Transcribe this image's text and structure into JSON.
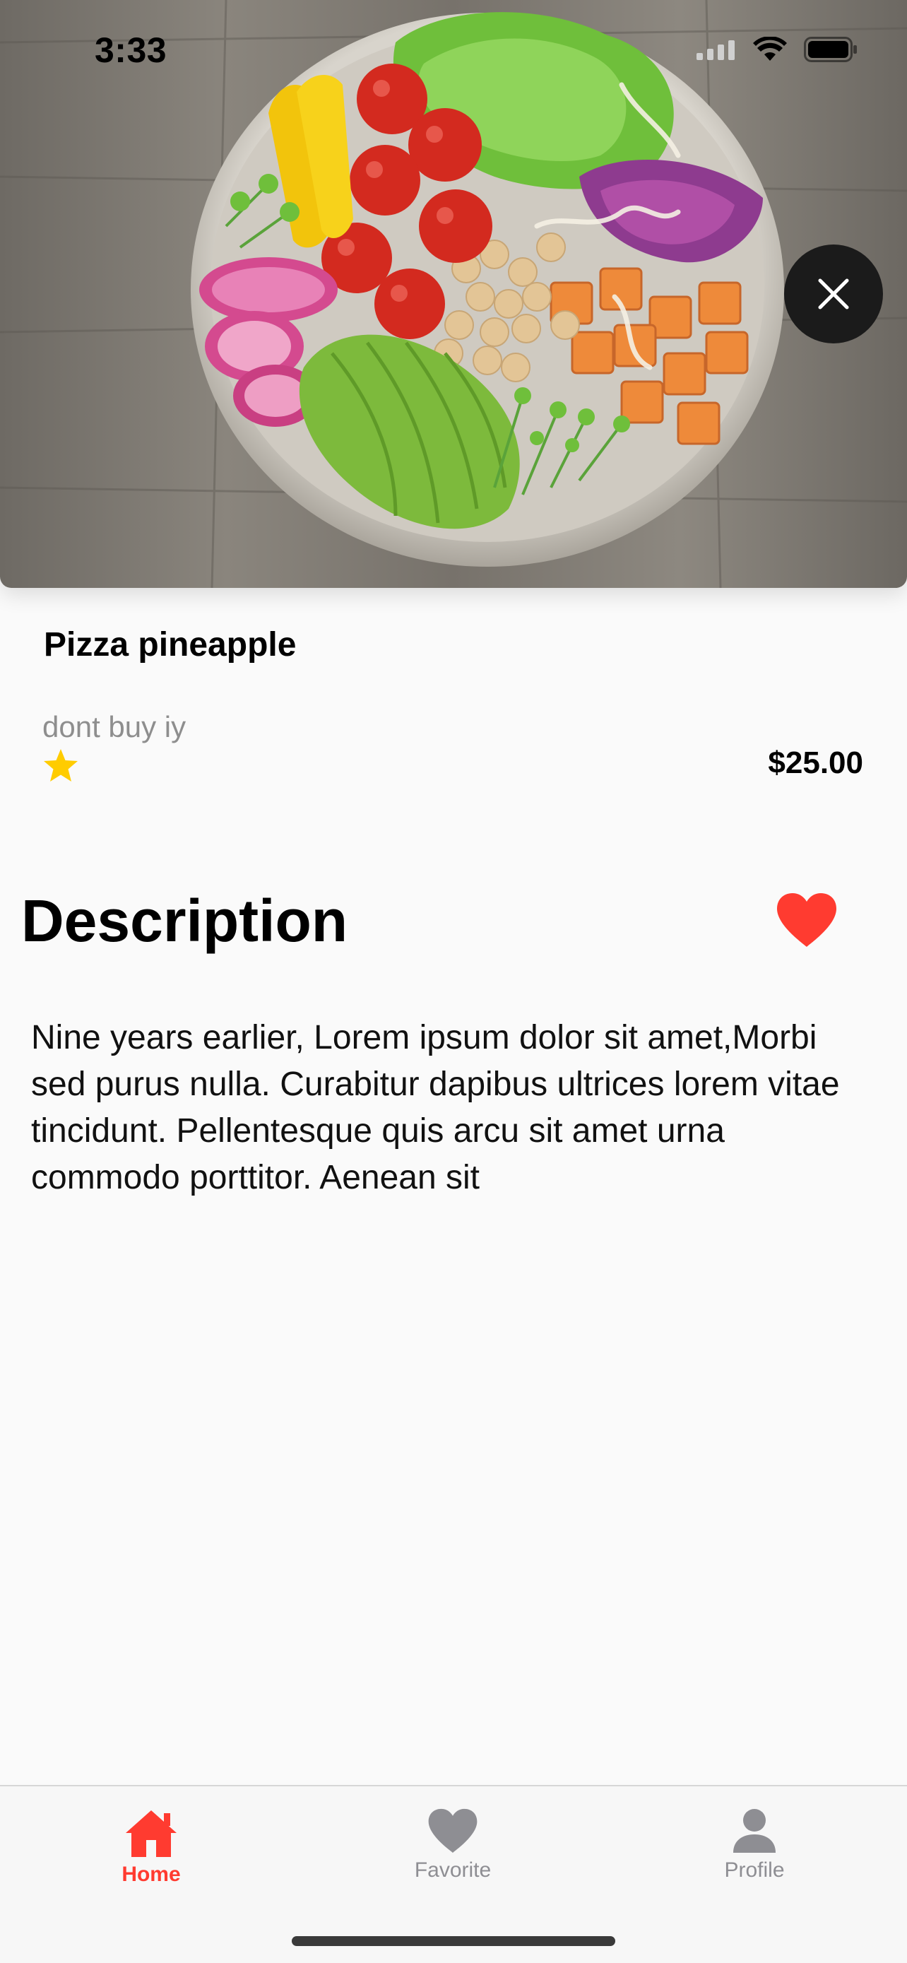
{
  "status_bar": {
    "time": "3:33"
  },
  "product": {
    "name": "Pizza pineapple",
    "subtitle": "dont buy iy",
    "price": "$25.00",
    "rating_icon": "star-icon"
  },
  "description": {
    "title": "Description",
    "body": "Nine years earlier, Lorem ipsum dolor sit amet,Morbi sed purus nulla. Curabitur dapibus ultrices lorem vitae tincidunt. Pellentesque quis arcu sit amet urna commodo porttitor. Aenean sit"
  },
  "tab_bar": {
    "tabs": [
      {
        "label": "Home",
        "icon": "home-icon",
        "active": true
      },
      {
        "label": "Favorite",
        "icon": "heart-icon",
        "active": false
      },
      {
        "label": "Profile",
        "icon": "person-icon",
        "active": false
      }
    ]
  },
  "colors": {
    "accent": "#ff3b30",
    "star": "#ffcc00",
    "inactive_tab": "#8e8e93",
    "close_button": "#1b1b1b"
  }
}
